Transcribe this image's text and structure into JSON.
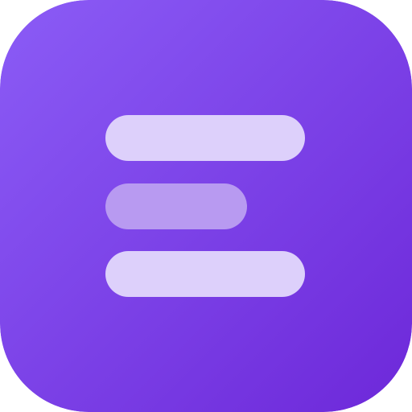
{
  "icon": {
    "name": "menu-lines-app-icon",
    "colors": {
      "gradient_start": "#8B5CF6",
      "gradient_end": "#6D28D9",
      "bar_light": "#DDD0FB",
      "bar_mid": "#B89AF1"
    },
    "bars": [
      {
        "name": "top-bar",
        "relative_length": 1.0,
        "color_key": "bar_light"
      },
      {
        "name": "middle-bar",
        "relative_length": 0.71,
        "color_key": "bar_mid"
      },
      {
        "name": "bottom-bar",
        "relative_length": 1.0,
        "color_key": "bar_light"
      }
    ]
  }
}
